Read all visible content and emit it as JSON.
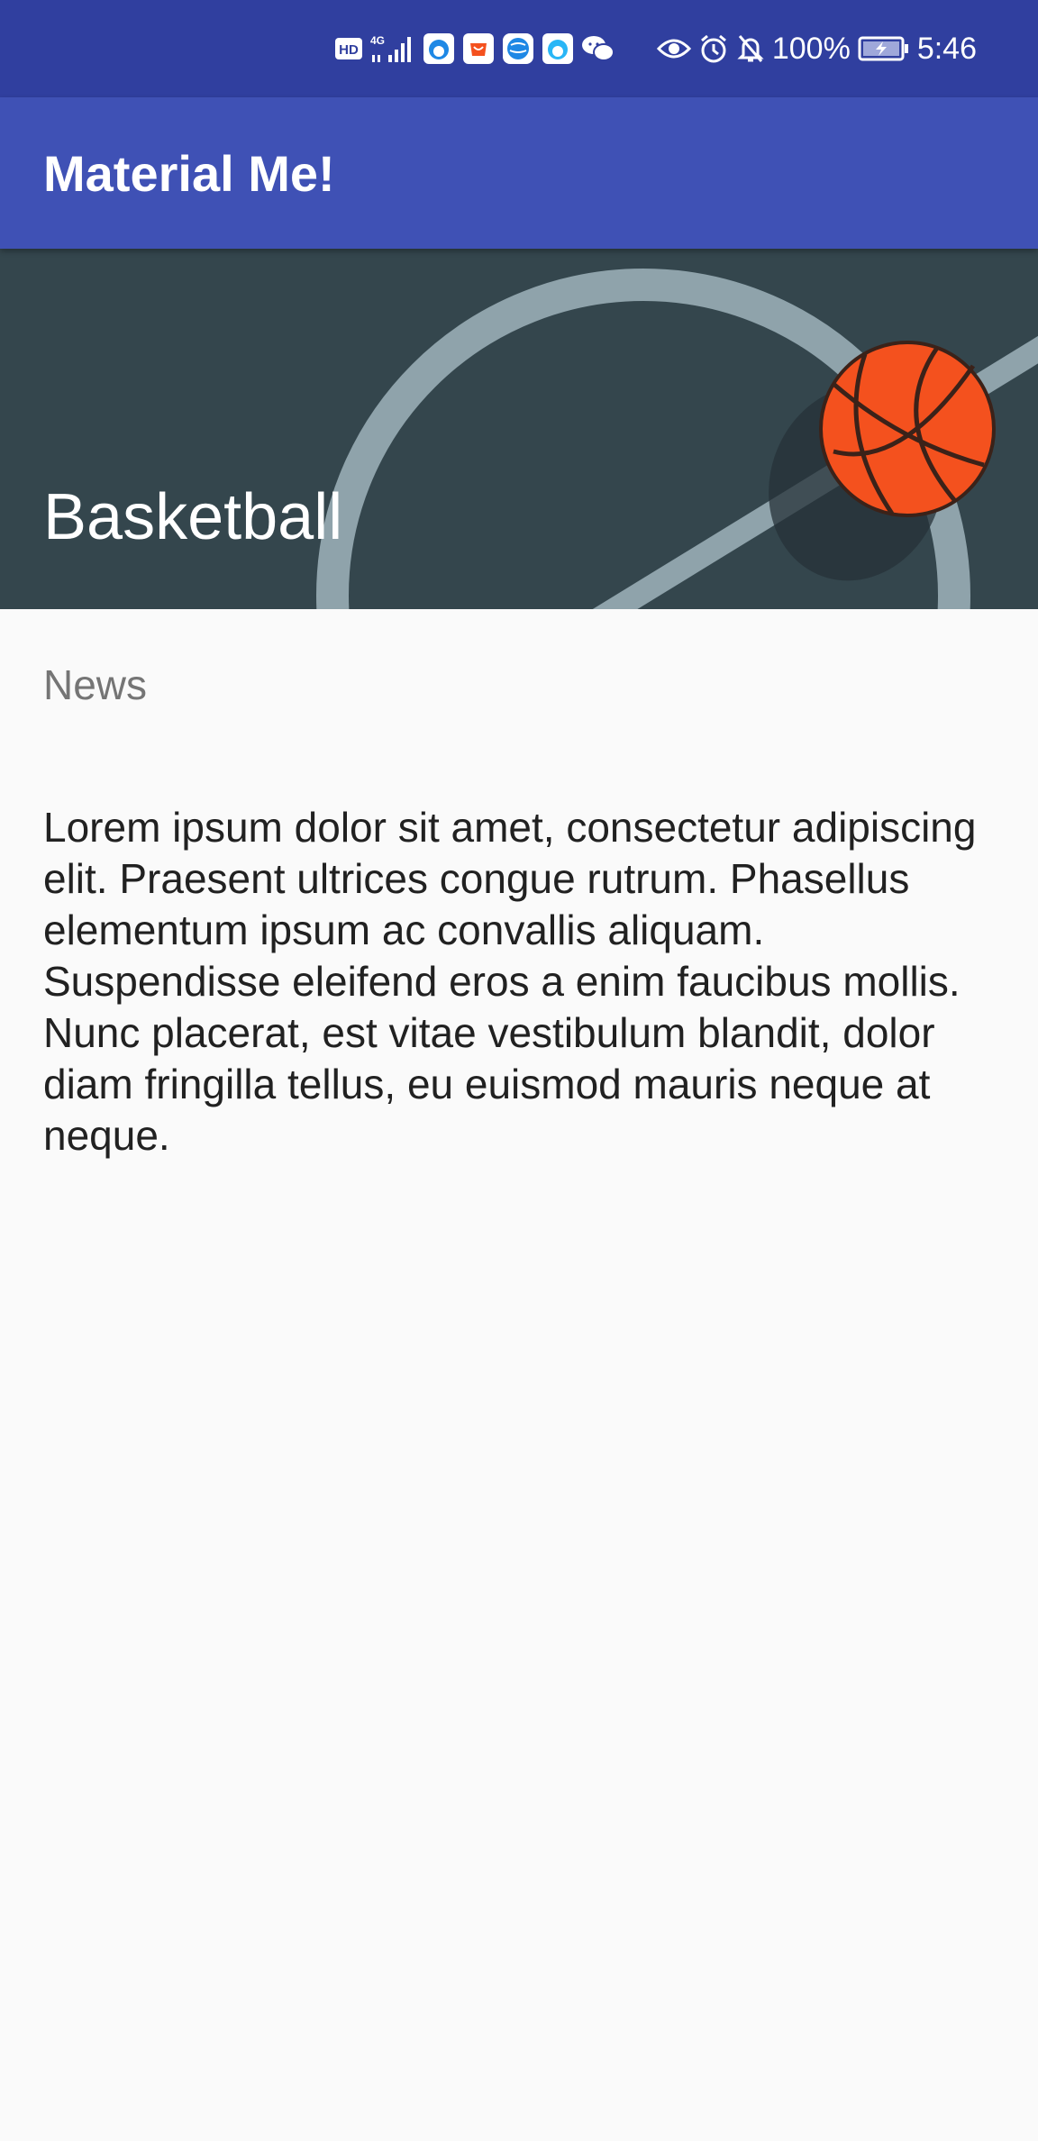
{
  "status_bar": {
    "battery_percent": "100%",
    "time": "5:46",
    "network_label": "4G",
    "hd_label": "HD",
    "icons": [
      "hd-icon",
      "4g-signal-icon",
      "browser-app-icon",
      "shopping-app-icon",
      "globe-app-icon",
      "browser-app-icon-2",
      "wechat-icon",
      "eye-icon",
      "alarm-icon",
      "notifications-off-icon",
      "battery-charging-icon"
    ]
  },
  "app_bar": {
    "title": "Material Me!",
    "color": "#3f51b5"
  },
  "card": {
    "title": "Basketball",
    "subtitle": "News",
    "body": "Lorem ipsum dolor sit amet, consectetur adipiscing elit. Praesent ultrices congue rutrum. Phasellus elementum ipsum ac convallis aliquam. Suspendisse eleifend eros a enim faucibus mollis. Nunc placerat, est vitae vestibulum blandit, dolor diam fringilla tellus, eu euismod mauris neque at neque.",
    "image": "basketball-court-illustration",
    "image_background": "#34464d",
    "ball_color": "#f4511e"
  }
}
